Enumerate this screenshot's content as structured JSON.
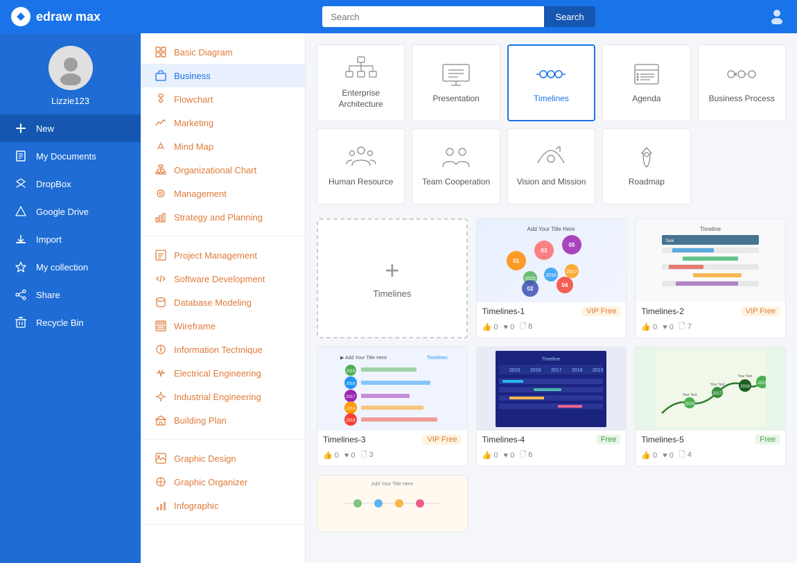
{
  "header": {
    "logo_text": "edraw max",
    "search_placeholder": "Search",
    "search_button": "Search"
  },
  "sidebar": {
    "username": "Lizzie123",
    "items": [
      {
        "id": "new",
        "label": "New",
        "icon": "plus"
      },
      {
        "id": "my-documents",
        "label": "My Documents",
        "icon": "file"
      },
      {
        "id": "dropbox",
        "label": "DropBox",
        "icon": "dropbox"
      },
      {
        "id": "google-drive",
        "label": "Google Drive",
        "icon": "drive"
      },
      {
        "id": "import",
        "label": "Import",
        "icon": "import"
      },
      {
        "id": "my-collection",
        "label": "My collection",
        "icon": "star"
      },
      {
        "id": "share",
        "label": "Share",
        "icon": "share"
      },
      {
        "id": "recycle-bin",
        "label": "Recycle Bin",
        "icon": "trash"
      }
    ]
  },
  "menu": {
    "sections": [
      {
        "items": [
          {
            "id": "basic-diagram",
            "label": "Basic Diagram",
            "active": false
          },
          {
            "id": "business",
            "label": "Business",
            "active": true
          },
          {
            "id": "flowchart",
            "label": "Flowchart",
            "active": false
          },
          {
            "id": "marketing",
            "label": "Marketing",
            "active": false
          },
          {
            "id": "mind-map",
            "label": "Mind Map",
            "active": false
          },
          {
            "id": "org-chart",
            "label": "Organizational Chart",
            "active": false
          },
          {
            "id": "management",
            "label": "Management",
            "active": false
          },
          {
            "id": "strategy",
            "label": "Strategy and Planning",
            "active": false
          }
        ]
      },
      {
        "items": [
          {
            "id": "project-mgmt",
            "label": "Project Management",
            "active": false
          },
          {
            "id": "software-dev",
            "label": "Software Development",
            "active": false
          },
          {
            "id": "database",
            "label": "Database Modeling",
            "active": false
          },
          {
            "id": "wireframe",
            "label": "Wireframe",
            "active": false
          },
          {
            "id": "info-tech",
            "label": "Information Technique",
            "active": false
          },
          {
            "id": "electrical",
            "label": "Electrical Engineering",
            "active": false
          },
          {
            "id": "industrial",
            "label": "Industrial Engineering",
            "active": false
          },
          {
            "id": "building",
            "label": "Building Plan",
            "active": false
          }
        ]
      },
      {
        "items": [
          {
            "id": "graphic-design",
            "label": "Graphic Design",
            "active": false
          },
          {
            "id": "graphic-organizer",
            "label": "Graphic Organizer",
            "active": false
          },
          {
            "id": "infographic",
            "label": "Infographic",
            "active": false
          }
        ]
      }
    ]
  },
  "categories": [
    {
      "id": "enterprise",
      "label": "Enterprise Architecture",
      "selected": false
    },
    {
      "id": "presentation",
      "label": "Presentation",
      "selected": false
    },
    {
      "id": "timelines",
      "label": "Timelines",
      "selected": true
    },
    {
      "id": "agenda",
      "label": "Agenda",
      "selected": false
    },
    {
      "id": "business-process",
      "label": "Business Process",
      "selected": false
    },
    {
      "id": "human-resource",
      "label": "Human Resource",
      "selected": false
    },
    {
      "id": "team-cooperation",
      "label": "Team Cooperation",
      "selected": false
    },
    {
      "id": "vision-mission",
      "label": "Vision and Mission",
      "selected": false
    },
    {
      "id": "roadmap",
      "label": "Roadmap",
      "selected": false
    }
  ],
  "templates": {
    "new_label": "Timelines",
    "items": [
      {
        "id": "t1",
        "name": "Timelines-1",
        "badge": "VIP Free",
        "badge_type": "vip",
        "likes": 0,
        "hearts": 0,
        "copies": 8
      },
      {
        "id": "t2",
        "name": "Timelines-2",
        "badge": "VIP Free",
        "badge_type": "vip",
        "likes": 0,
        "hearts": 0,
        "copies": 7
      },
      {
        "id": "t3",
        "name": "Timelines-3",
        "badge": "VIP Free",
        "badge_type": "vip",
        "likes": 0,
        "hearts": 0,
        "copies": 3
      },
      {
        "id": "t4",
        "name": "Timelines-4",
        "badge": "Free",
        "badge_type": "free",
        "likes": 0,
        "hearts": 0,
        "copies": 6
      },
      {
        "id": "t5",
        "name": "Timelines-5",
        "badge": "Free",
        "badge_type": "free",
        "likes": 0,
        "hearts": 0,
        "copies": 4
      }
    ]
  }
}
